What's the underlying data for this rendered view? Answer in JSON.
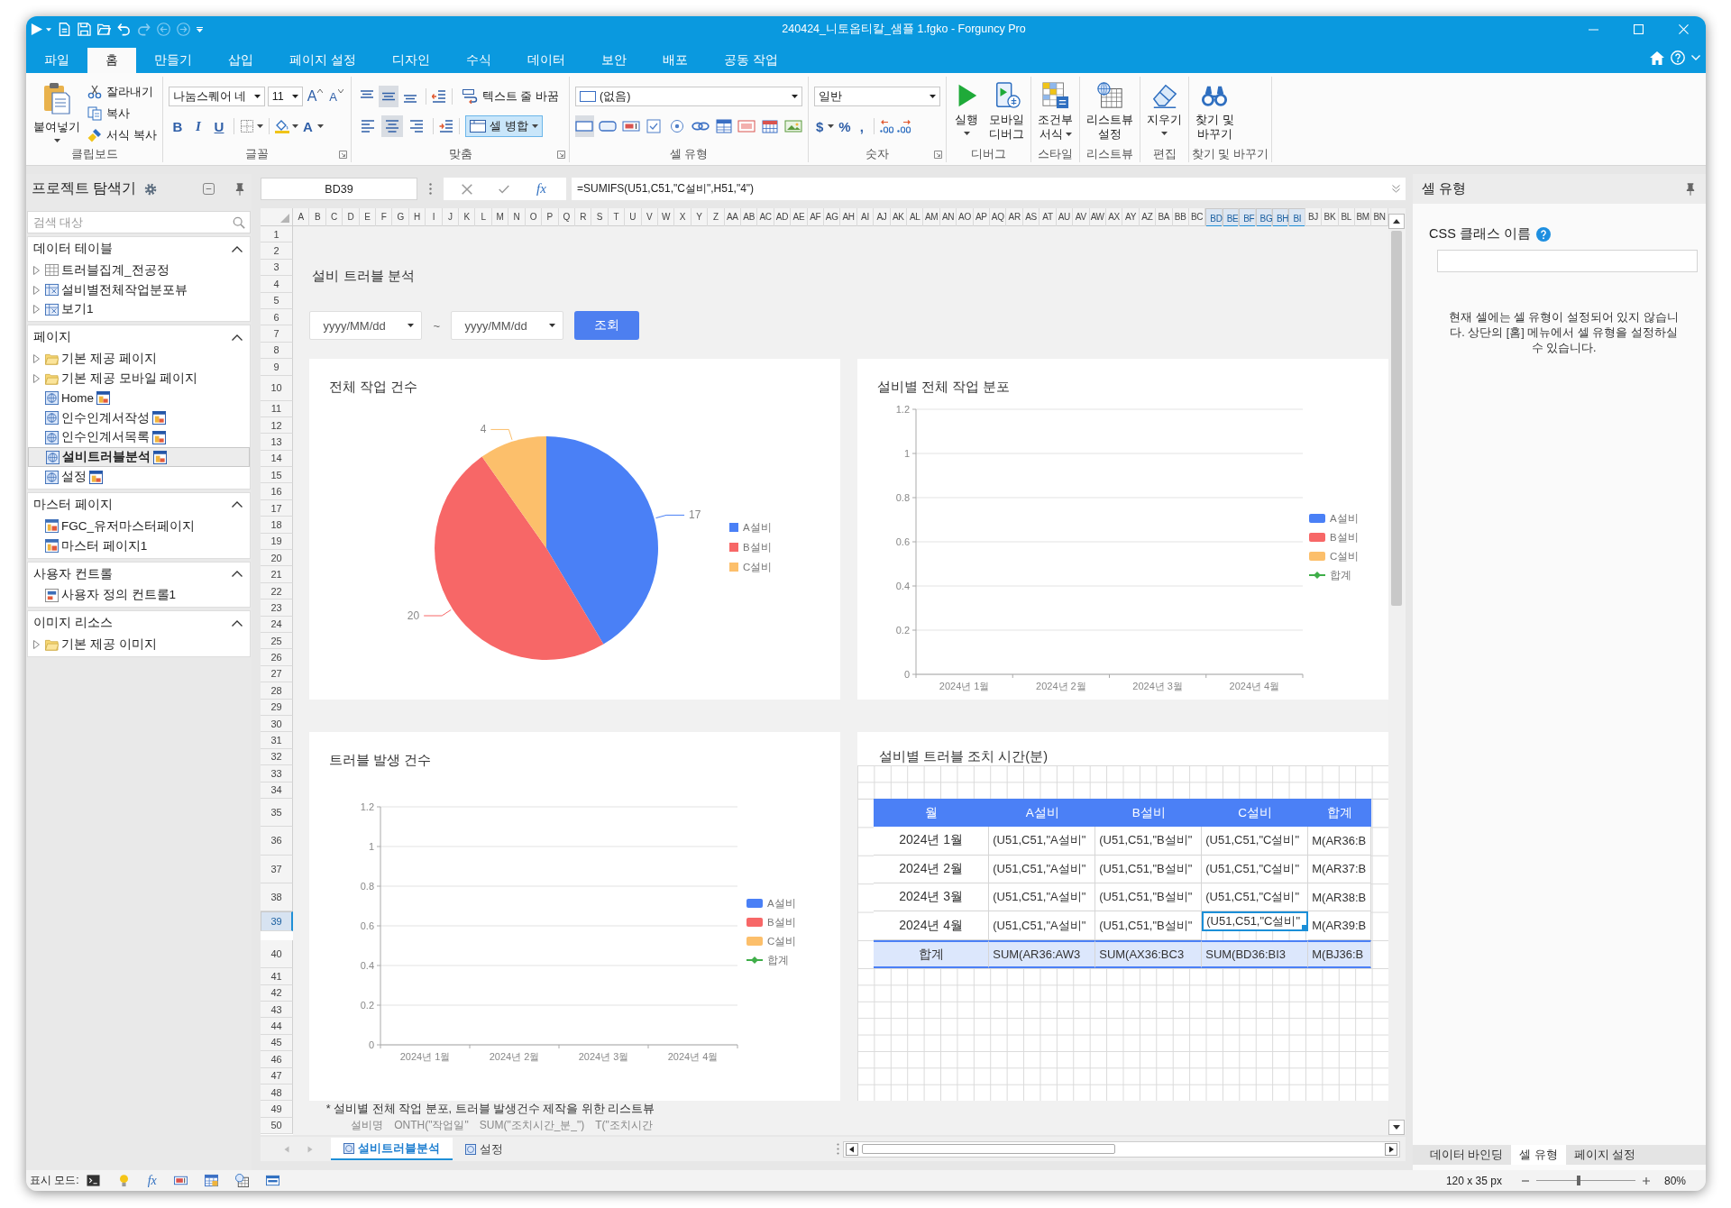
{
  "window": {
    "title": "240424_니토옵티칼_샘플 1.fgko - Forguncy Pro",
    "quick_access": [
      {
        "kind": "run",
        "disabled": false
      },
      {
        "kind": "new",
        "disabled": false
      },
      {
        "kind": "save",
        "disabled": false
      },
      {
        "kind": "open",
        "disabled": false
      },
      {
        "kind": "undo",
        "disabled": false
      },
      {
        "kind": "redo",
        "disabled": true
      },
      {
        "kind": "back",
        "disabled": true
      },
      {
        "kind": "forward",
        "disabled": true
      }
    ]
  },
  "ribbon_tabs": [
    {
      "label": "파일",
      "selected": false
    },
    {
      "label": "홈",
      "selected": true
    },
    {
      "label": "만들기",
      "selected": false
    },
    {
      "label": "삽입",
      "selected": false
    },
    {
      "label": "페이지 설정",
      "selected": false
    },
    {
      "label": "디자인",
      "selected": false
    },
    {
      "label": "수식",
      "selected": false
    },
    {
      "label": "데이터",
      "selected": false
    },
    {
      "label": "보안",
      "selected": false
    },
    {
      "label": "배포",
      "selected": false
    },
    {
      "label": "공동 작업",
      "selected": false
    }
  ],
  "ribbon": {
    "clipboard": {
      "label": "클립보드",
      "launcher": false,
      "paste": "붙여넣기",
      "items": [
        {
          "kind": "cut",
          "label": "잘라내기"
        },
        {
          "kind": "copy",
          "label": "복사"
        },
        {
          "kind": "painter",
          "label": "서식 복사"
        }
      ]
    },
    "font": {
      "label": "글꼴",
      "launcher": true,
      "font_name": "나눔스퀘어 네",
      "font_size": "11",
      "grow": "A",
      "shrink": "A",
      "styles": [
        {
          "kind": "bold",
          "label": "B"
        },
        {
          "kind": "italic",
          "label": "I"
        },
        {
          "kind": "underline",
          "label": "U"
        }
      ],
      "font_color": "A"
    },
    "alignment": {
      "label": "맞춤",
      "launcher": true,
      "vertical": [
        {
          "kind": "top",
          "selected": false
        },
        {
          "kind": "middle",
          "selected": true
        },
        {
          "kind": "bottom",
          "selected": false
        }
      ],
      "horizontal": [
        {
          "kind": "left",
          "selected": false
        },
        {
          "kind": "center",
          "selected": true
        },
        {
          "kind": "right",
          "selected": false
        }
      ],
      "wrap": {
        "label": "텍스트 줄 바꿈",
        "on": false
      },
      "merge": {
        "label": "셀 병합",
        "on": true
      }
    },
    "cell_type": {
      "label": "셀 유형",
      "launcher": false,
      "value": "(없음)",
      "types": [
        {
          "kind": "none",
          "selected": true
        },
        {
          "kind": "button",
          "selected": false
        },
        {
          "kind": "textbox",
          "selected": false
        },
        {
          "kind": "checkbox",
          "selected": false
        },
        {
          "kind": "radio",
          "selected": false
        },
        {
          "kind": "link",
          "selected": false
        },
        {
          "kind": "list",
          "selected": false
        },
        {
          "kind": "number",
          "selected": false
        },
        {
          "kind": "calendar",
          "selected": false
        },
        {
          "kind": "image",
          "selected": false
        }
      ]
    },
    "number": {
      "label": "숫자",
      "launcher": true,
      "format": "일반",
      "currency": "$",
      "percent": "%",
      "comma": ","
    },
    "commands": [
      {
        "label": "디버그",
        "buttons": [
          {
            "kind": "run",
            "lines": [
              "실행"
            ],
            "caret": true
          },
          {
            "kind": "mobile",
            "lines": [
              "모바일",
              "디버그"
            ],
            "caret": false
          }
        ]
      },
      {
        "label": "스타일",
        "buttons": [
          {
            "kind": "conditional",
            "lines": [
              "조건부",
              "서식"
            ],
            "caret": true
          }
        ]
      },
      {
        "label": "리스트뷰",
        "buttons": [
          {
            "kind": "listview",
            "lines": [
              "리스트뷰",
              "설정"
            ],
            "caret": false
          }
        ]
      },
      {
        "label": "편집",
        "buttons": [
          {
            "kind": "eraser",
            "lines": [
              "지우기"
            ],
            "caret": true
          }
        ]
      },
      {
        "label": "찾기 및 바꾸기",
        "buttons": [
          {
            "kind": "find",
            "lines": [
              "찾기 및",
              "바꾸기"
            ],
            "caret": false
          }
        ]
      }
    ]
  },
  "explorer": {
    "title": "프로젝트 탐색기",
    "search": {
      "placeholder": "검색 대상"
    },
    "sections": [
      {
        "title": "데이터 테이블",
        "expanded": true,
        "items": [
          {
            "label": "트러블집계_전공정",
            "kind": "table",
            "expanded": false,
            "selected": false
          },
          {
            "label": "설비별전체작업분포뷰",
            "kind": "view",
            "expanded": false,
            "selected": false
          },
          {
            "label": "보기1",
            "kind": "view",
            "expanded": false,
            "selected": false
          }
        ]
      },
      {
        "title": "페이지",
        "expanded": true,
        "items": [
          {
            "label": "기본 제공 페이지",
            "kind": "folder",
            "expanded": false,
            "selected": false
          },
          {
            "label": "기본 제공 모바일 페이지",
            "kind": "folder",
            "expanded": false,
            "selected": false
          },
          {
            "label": "Home",
            "kind": "page",
            "selected": false
          },
          {
            "label": "인수인계서작성",
            "kind": "page",
            "selected": false
          },
          {
            "label": "인수인계서목록",
            "kind": "page",
            "selected": false
          },
          {
            "label": "설비트러블분석",
            "kind": "page",
            "selected": true
          },
          {
            "label": "설정",
            "kind": "page",
            "selected": false
          }
        ]
      },
      {
        "title": "마스터 페이지",
        "expanded": true,
        "items": [
          {
            "label": "FGC_유저마스터페이지",
            "kind": "master",
            "selected": false
          },
          {
            "label": "마스터 페이지1",
            "kind": "master",
            "selected": false
          }
        ]
      },
      {
        "title": "사용자 컨트롤",
        "expanded": true,
        "items": [
          {
            "label": "사용자 정의 컨트롤1",
            "kind": "control",
            "selected": false
          }
        ]
      },
      {
        "title": "이미지 리소스",
        "expanded": true,
        "items": [
          {
            "label": "기본 제공 이미지",
            "kind": "folder",
            "expanded": false,
            "selected": false
          }
        ]
      }
    ]
  },
  "formula_bar": {
    "cell": "BD39",
    "fx": "fx",
    "formula": "=SUMIFS(U51,C51,\"C설비\",H51,\"4\")"
  },
  "sheet": {
    "columns": [
      {
        "label": "A",
        "selected": false
      },
      {
        "label": "B",
        "selected": false
      },
      {
        "label": "C",
        "selected": false
      },
      {
        "label": "D",
        "selected": false
      },
      {
        "label": "E",
        "selected": false
      },
      {
        "label": "F",
        "selected": false
      },
      {
        "label": "G",
        "selected": false
      },
      {
        "label": "H",
        "selected": false
      },
      {
        "label": "I",
        "selected": false
      },
      {
        "label": "J",
        "selected": false
      },
      {
        "label": "K",
        "selected": false
      },
      {
        "label": "L",
        "selected": false
      },
      {
        "label": "M",
        "selected": false
      },
      {
        "label": "N",
        "selected": false
      },
      {
        "label": "O",
        "selected": false
      },
      {
        "label": "P",
        "selected": false
      },
      {
        "label": "Q",
        "selected": false
      },
      {
        "label": "R",
        "selected": false
      },
      {
        "label": "S",
        "selected": false
      },
      {
        "label": "T",
        "selected": false
      },
      {
        "label": "U",
        "selected": false
      },
      {
        "label": "V",
        "selected": false
      },
      {
        "label": "W",
        "selected": false
      },
      {
        "label": "X",
        "selected": false
      },
      {
        "label": "Y",
        "selected": false
      },
      {
        "label": "Z",
        "selected": false
      },
      {
        "label": "AA",
        "selected": false
      },
      {
        "label": "AB",
        "selected": false
      },
      {
        "label": "AC",
        "selected": false
      },
      {
        "label": "AD",
        "selected": false
      },
      {
        "label": "AE",
        "selected": false
      },
      {
        "label": "AF",
        "selected": false
      },
      {
        "label": "AG",
        "selected": false
      },
      {
        "label": "AH",
        "selected": false
      },
      {
        "label": "AI",
        "selected": false
      },
      {
        "label": "AJ",
        "selected": false
      },
      {
        "label": "AK",
        "selected": false
      },
      {
        "label": "AL",
        "selected": false
      },
      {
        "label": "AM",
        "selected": false
      },
      {
        "label": "AN",
        "selected": false
      },
      {
        "label": "AO",
        "selected": false
      },
      {
        "label": "AP",
        "selected": false
      },
      {
        "label": "AQ",
        "selected": false
      },
      {
        "label": "AR",
        "selected": false
      },
      {
        "label": "AS",
        "selected": false
      },
      {
        "label": "AT",
        "selected": false
      },
      {
        "label": "AU",
        "selected": false
      },
      {
        "label": "AV",
        "selected": false
      },
      {
        "label": "AW",
        "selected": false
      },
      {
        "label": "AX",
        "selected": false
      },
      {
        "label": "AY",
        "selected": false
      },
      {
        "label": "AZ",
        "selected": false
      },
      {
        "label": "BA",
        "selected": false
      },
      {
        "label": "BB",
        "selected": false
      },
      {
        "label": "BC",
        "selected": false
      },
      {
        "label": "BD",
        "selected": true
      },
      {
        "label": "BE",
        "selected": true
      },
      {
        "label": "BF",
        "selected": true
      },
      {
        "label": "BG",
        "selected": true
      },
      {
        "label": "BH",
        "selected": true
      },
      {
        "label": "BI",
        "selected": true
      },
      {
        "label": "BJ",
        "selected": false
      },
      {
        "label": "BK",
        "selected": false
      },
      {
        "label": "BL",
        "selected": false
      },
      {
        "label": "BM",
        "selected": false
      },
      {
        "label": "BN",
        "selected": false
      }
    ],
    "rows": [
      {
        "label": "1",
        "selected": false
      },
      {
        "label": "2",
        "selected": false
      },
      {
        "label": "3",
        "selected": false
      },
      {
        "label": "4",
        "selected": false
      },
      {
        "label": "5",
        "selected": false
      },
      {
        "label": "6",
        "selected": false
      },
      {
        "label": "7",
        "selected": false
      },
      {
        "label": "8",
        "selected": false
      },
      {
        "label": "9",
        "selected": false
      },
      {
        "label": "10",
        "selected": false
      },
      {
        "label": "11",
        "selected": false
      },
      {
        "label": "12",
        "selected": false
      },
      {
        "label": "13",
        "selected": false
      },
      {
        "label": "14",
        "selected": false
      },
      {
        "label": "15",
        "selected": false
      },
      {
        "label": "16",
        "selected": false
      },
      {
        "label": "17",
        "selected": false
      },
      {
        "label": "18",
        "selected": false
      },
      {
        "label": "19",
        "selected": false
      },
      {
        "label": "20",
        "selected": false
      },
      {
        "label": "21",
        "selected": false
      },
      {
        "label": "22",
        "selected": false
      },
      {
        "label": "23",
        "selected": false
      },
      {
        "label": "24",
        "selected": false
      },
      {
        "label": "25",
        "selected": false
      },
      {
        "label": "26",
        "selected": false
      },
      {
        "label": "27",
        "selected": false
      },
      {
        "label": "28",
        "selected": false
      },
      {
        "label": "29",
        "selected": false
      },
      {
        "label": "30",
        "selected": false
      },
      {
        "label": "31",
        "selected": false
      },
      {
        "label": "32",
        "selected": false
      },
      {
        "label": "33",
        "selected": false
      },
      {
        "label": "34",
        "selected": false
      },
      {
        "label": "35",
        "selected": false
      },
      {
        "label": "36",
        "selected": false
      },
      {
        "label": "37",
        "selected": false
      },
      {
        "label": "38",
        "selected": false
      },
      {
        "label": "39",
        "selected": true
      },
      {
        "label": "40",
        "selected": false
      },
      {
        "label": "41",
        "selected": false
      },
      {
        "label": "42",
        "selected": false
      },
      {
        "label": "43",
        "selected": false
      },
      {
        "label": "44",
        "selected": false
      },
      {
        "label": "45",
        "selected": false
      },
      {
        "label": "46",
        "selected": false
      },
      {
        "label": "47",
        "selected": false
      },
      {
        "label": "48",
        "selected": false
      },
      {
        "label": "49",
        "selected": false
      },
      {
        "label": "50",
        "selected": false
      }
    ],
    "page": {
      "title": "설비 트러블 분석",
      "date_from": {
        "placeholder": "yyyy/MM/dd"
      },
      "range_separator": "~",
      "date_to": {
        "placeholder": "yyyy/MM/dd"
      },
      "search_button": "조회",
      "cards": [
        {
          "kind": "chart",
          "chart_data": {
            "type": "pie",
            "title": "전체 작업 건수",
            "categories": [
              "A설비",
              "B설비",
              "C설비"
            ],
            "values": [
              17,
              20,
              4
            ],
            "colors": [
              "#4a80f6",
              "#f76767",
              "#fcbf6b"
            ],
            "data_labels": true,
            "legend": "right"
          }
        },
        {
          "kind": "chart",
          "chart_data": {
            "type": "bar",
            "title": "설비별 전체 작업 분포",
            "categories": [
              "2024년 1월",
              "2024년 2월",
              "2024년 3월",
              "2024년 4월"
            ],
            "series": [
              {
                "name": "A설비",
                "type": "bar",
                "color": "#4a80f6",
                "values": [
                  null,
                  null,
                  null,
                  null
                ]
              },
              {
                "name": "B설비",
                "type": "bar",
                "color": "#f76767",
                "values": [
                  null,
                  null,
                  null,
                  null
                ]
              },
              {
                "name": "C설비",
                "type": "bar",
                "color": "#fcbf6b",
                "values": [
                  null,
                  null,
                  null,
                  null
                ]
              },
              {
                "name": "합계",
                "type": "line",
                "color": "#3fae49",
                "values": [
                  null,
                  null,
                  null,
                  null
                ]
              }
            ],
            "ylim": [
              0,
              1.2
            ],
            "yticks": [
              0,
              0.2,
              0.4,
              0.6,
              0.8,
              1,
              1.2
            ],
            "grid": true,
            "legend": "right"
          }
        },
        {
          "kind": "chart",
          "chart_data": {
            "type": "bar",
            "title": "트러블 발생 건수",
            "categories": [
              "2024년 1월",
              "2024년 2월",
              "2024년 3월",
              "2024년 4월"
            ],
            "series": [
              {
                "name": "A설비",
                "type": "bar",
                "color": "#4a80f6",
                "values": [
                  null,
                  null,
                  null,
                  null
                ]
              },
              {
                "name": "B설비",
                "type": "bar",
                "color": "#f76767",
                "values": [
                  null,
                  null,
                  null,
                  null
                ]
              },
              {
                "name": "C설비",
                "type": "bar",
                "color": "#fcbf6b",
                "values": [
                  null,
                  null,
                  null,
                  null
                ]
              },
              {
                "name": "합계",
                "type": "line",
                "color": "#3fae49",
                "values": [
                  null,
                  null,
                  null,
                  null
                ]
              }
            ],
            "ylim": [
              0,
              1.2
            ],
            "yticks": [
              0,
              0.2,
              0.4,
              0.6,
              0.8,
              1,
              1.2
            ],
            "grid": true,
            "legend": "right"
          }
        },
        {
          "kind": "table",
          "title": "설비별 트러블 조치 시간(분)",
          "table": {
            "columns": [
              "월",
              "A설비",
              "B설비",
              "C설비",
              "합계"
            ],
            "rows": [
              {
                "kind": "data",
                "cells": [
                  {
                    "text": "2024년 1월",
                    "selected": false
                  },
                  {
                    "text": "(U51,C51,\"A설비\"",
                    "selected": false
                  },
                  {
                    "text": "(U51,C51,\"B설비\"",
                    "selected": false
                  },
                  {
                    "text": "(U51,C51,\"C설비\"",
                    "selected": false
                  },
                  {
                    "text": "M(AR36:B",
                    "selected": false
                  }
                ]
              },
              {
                "kind": "data",
                "cells": [
                  {
                    "text": "2024년 2월",
                    "selected": false
                  },
                  {
                    "text": "(U51,C51,\"A설비\"",
                    "selected": false
                  },
                  {
                    "text": "(U51,C51,\"B설비\"",
                    "selected": false
                  },
                  {
                    "text": "(U51,C51,\"C설비\"",
                    "selected": false
                  },
                  {
                    "text": "M(AR37:B",
                    "selected": false
                  }
                ]
              },
              {
                "kind": "data",
                "cells": [
                  {
                    "text": "2024년 3월",
                    "selected": false
                  },
                  {
                    "text": "(U51,C51,\"A설비\"",
                    "selected": false
                  },
                  {
                    "text": "(U51,C51,\"B설비\"",
                    "selected": false
                  },
                  {
                    "text": "(U51,C51,\"C설비\"",
                    "selected": false
                  },
                  {
                    "text": "M(AR38:B",
                    "selected": false
                  }
                ]
              },
              {
                "kind": "data",
                "cells": [
                  {
                    "text": "2024년 4월",
                    "selected": false
                  },
                  {
                    "text": "(U51,C51,\"A설비\"",
                    "selected": false
                  },
                  {
                    "text": "(U51,C51,\"B설비\"",
                    "selected": false
                  },
                  {
                    "text": "(U51,C51,\"C설비\"",
                    "selected": true
                  },
                  {
                    "text": "M(AR39:B",
                    "selected": false
                  }
                ]
              },
              {
                "kind": "total",
                "cells": [
                  {
                    "text": "합계",
                    "selected": false
                  },
                  {
                    "text": "SUM(AR36:AW3",
                    "selected": false
                  },
                  {
                    "text": "SUM(AX36:BC3",
                    "selected": false
                  },
                  {
                    "text": "SUM(BD36:BI3",
                    "selected": false
                  },
                  {
                    "text": "M(BJ36:B",
                    "selected": false
                  }
                ]
              }
            ]
          }
        }
      ],
      "note": "* 설비별 전체 작업 분포, 트러블 발생건수 제작을 위한 리스트뷰",
      "listview_columns": [
        "설비명",
        "ONTH(\"작업일\"",
        "SUM(\"조치시간_분_\")",
        "T(\"조치시간"
      ]
    }
  },
  "sheet_tabs": [
    {
      "label": "설비트러블분석",
      "selected": true
    },
    {
      "label": "설정",
      "selected": false
    }
  ],
  "properties": {
    "title": "셀 유형",
    "css_class": {
      "label": "CSS 클래스 이름"
    },
    "message": "현재 셀에는 셀 유형이 설정되어 있지 않습니다. 상단의 [홈] 메뉴에서 셀 유형을 설정하실 수 있습니다.",
    "tabs": [
      {
        "label": "데이터 바인딩",
        "selected": false
      },
      {
        "label": "셀 유형",
        "selected": true
      },
      {
        "label": "페이지 설정",
        "selected": false
      }
    ]
  },
  "status_bar": {
    "mode_label": "표시 모드:",
    "modes": [
      {
        "kind": "script"
      },
      {
        "kind": "bulb"
      },
      {
        "kind": "formula",
        "label": "fx"
      },
      {
        "kind": "textbox"
      },
      {
        "kind": "table"
      },
      {
        "kind": "listview"
      },
      {
        "kind": "layout"
      }
    ],
    "size": "120 x 35 px",
    "zoom": {
      "level": 0.43,
      "reading": "80%"
    }
  }
}
